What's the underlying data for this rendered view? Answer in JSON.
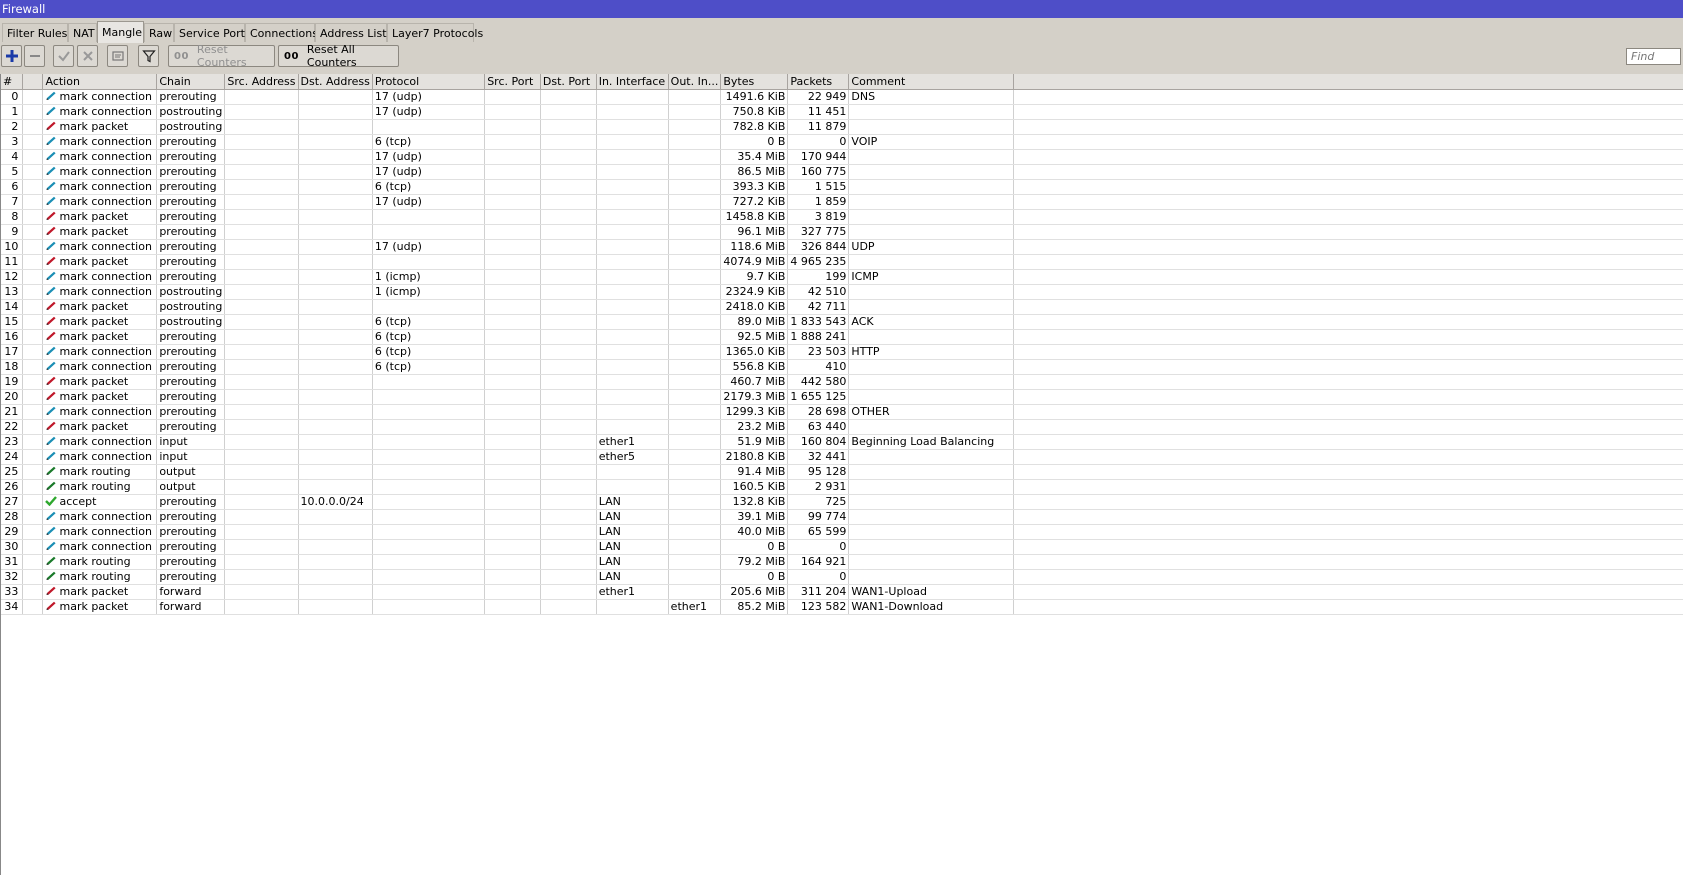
{
  "window": {
    "title": "Firewall"
  },
  "tabs": [
    "Filter Rules",
    "NAT",
    "Mangle",
    "Raw",
    "Service Ports",
    "Connections",
    "Address Lists",
    "Layer7 Protocols"
  ],
  "active_tab": "Mangle",
  "toolbar": {
    "reset_counters": "Reset Counters",
    "reset_all_counters": "Reset All Counters",
    "counter_glyph": "00",
    "find_placeholder": "Find"
  },
  "colors": {
    "title_bar": "#4e4ec8",
    "mark_connection": "#1b8fb5",
    "mark_packet": "#c0182a",
    "mark_routing": "#1a7a2a",
    "accept": "#2ea82e"
  },
  "table": {
    "columns": [
      "#",
      "",
      "Action",
      "Chain",
      "Src. Address",
      "Dst. Address",
      "Protocol",
      "Src. Port",
      "Dst. Port",
      "In. Interface",
      "Out. In...",
      "Bytes",
      "Packets",
      "Comment"
    ],
    "rows": [
      {
        "id": "0",
        "action": "mark connection",
        "chain": "prerouting",
        "src": "",
        "dst": "",
        "proto": "17 (udp)",
        "sport": "",
        "dport": "",
        "in_if": "",
        "out_if": "",
        "bytes": "1491.6 KiB",
        "packets": "22 949",
        "comment": "DNS"
      },
      {
        "id": "1",
        "action": "mark connection",
        "chain": "postrouting",
        "src": "",
        "dst": "",
        "proto": "17 (udp)",
        "sport": "",
        "dport": "",
        "in_if": "",
        "out_if": "",
        "bytes": "750.8 KiB",
        "packets": "11 451",
        "comment": ""
      },
      {
        "id": "2",
        "action": "mark packet",
        "chain": "postrouting",
        "src": "",
        "dst": "",
        "proto": "",
        "sport": "",
        "dport": "",
        "in_if": "",
        "out_if": "",
        "bytes": "782.8 KiB",
        "packets": "11 879",
        "comment": ""
      },
      {
        "id": "3",
        "action": "mark connection",
        "chain": "prerouting",
        "src": "",
        "dst": "",
        "proto": "6 (tcp)",
        "sport": "",
        "dport": "",
        "in_if": "",
        "out_if": "",
        "bytes": "0 B",
        "packets": "0",
        "comment": "VOIP"
      },
      {
        "id": "4",
        "action": "mark connection",
        "chain": "prerouting",
        "src": "",
        "dst": "",
        "proto": "17 (udp)",
        "sport": "",
        "dport": "",
        "in_if": "",
        "out_if": "",
        "bytes": "35.4 MiB",
        "packets": "170 944",
        "comment": ""
      },
      {
        "id": "5",
        "action": "mark connection",
        "chain": "prerouting",
        "src": "",
        "dst": "",
        "proto": "17 (udp)",
        "sport": "",
        "dport": "",
        "in_if": "",
        "out_if": "",
        "bytes": "86.5 MiB",
        "packets": "160 775",
        "comment": ""
      },
      {
        "id": "6",
        "action": "mark connection",
        "chain": "prerouting",
        "src": "",
        "dst": "",
        "proto": "6 (tcp)",
        "sport": "",
        "dport": "",
        "in_if": "",
        "out_if": "",
        "bytes": "393.3 KiB",
        "packets": "1 515",
        "comment": ""
      },
      {
        "id": "7",
        "action": "mark connection",
        "chain": "prerouting",
        "src": "",
        "dst": "",
        "proto": "17 (udp)",
        "sport": "",
        "dport": "",
        "in_if": "",
        "out_if": "",
        "bytes": "727.2 KiB",
        "packets": "1 859",
        "comment": ""
      },
      {
        "id": "8",
        "action": "mark packet",
        "chain": "prerouting",
        "src": "",
        "dst": "",
        "proto": "",
        "sport": "",
        "dport": "",
        "in_if": "",
        "out_if": "",
        "bytes": "1458.8 KiB",
        "packets": "3 819",
        "comment": ""
      },
      {
        "id": "9",
        "action": "mark packet",
        "chain": "prerouting",
        "src": "",
        "dst": "",
        "proto": "",
        "sport": "",
        "dport": "",
        "in_if": "",
        "out_if": "",
        "bytes": "96.1 MiB",
        "packets": "327 775",
        "comment": ""
      },
      {
        "id": "10",
        "action": "mark connection",
        "chain": "prerouting",
        "src": "",
        "dst": "",
        "proto": "17 (udp)",
        "sport": "",
        "dport": "",
        "in_if": "",
        "out_if": "",
        "bytes": "118.6 MiB",
        "packets": "326 844",
        "comment": "UDP"
      },
      {
        "id": "11",
        "action": "mark packet",
        "chain": "prerouting",
        "src": "",
        "dst": "",
        "proto": "",
        "sport": "",
        "dport": "",
        "in_if": "",
        "out_if": "",
        "bytes": "4074.9 MiB",
        "packets": "4 965 235",
        "comment": ""
      },
      {
        "id": "12",
        "action": "mark connection",
        "chain": "prerouting",
        "src": "",
        "dst": "",
        "proto": "1 (icmp)",
        "sport": "",
        "dport": "",
        "in_if": "",
        "out_if": "",
        "bytes": "9.7 KiB",
        "packets": "199",
        "comment": "ICMP"
      },
      {
        "id": "13",
        "action": "mark connection",
        "chain": "postrouting",
        "src": "",
        "dst": "",
        "proto": "1 (icmp)",
        "sport": "",
        "dport": "",
        "in_if": "",
        "out_if": "",
        "bytes": "2324.9 KiB",
        "packets": "42 510",
        "comment": ""
      },
      {
        "id": "14",
        "action": "mark packet",
        "chain": "postrouting",
        "src": "",
        "dst": "",
        "proto": "",
        "sport": "",
        "dport": "",
        "in_if": "",
        "out_if": "",
        "bytes": "2418.0 KiB",
        "packets": "42 711",
        "comment": ""
      },
      {
        "id": "15",
        "action": "mark packet",
        "chain": "postrouting",
        "src": "",
        "dst": "",
        "proto": "6 (tcp)",
        "sport": "",
        "dport": "",
        "in_if": "",
        "out_if": "",
        "bytes": "89.0 MiB",
        "packets": "1 833 543",
        "comment": "ACK"
      },
      {
        "id": "16",
        "action": "mark packet",
        "chain": "prerouting",
        "src": "",
        "dst": "",
        "proto": "6 (tcp)",
        "sport": "",
        "dport": "",
        "in_if": "",
        "out_if": "",
        "bytes": "92.5 MiB",
        "packets": "1 888 241",
        "comment": ""
      },
      {
        "id": "17",
        "action": "mark connection",
        "chain": "prerouting",
        "src": "",
        "dst": "",
        "proto": "6 (tcp)",
        "sport": "",
        "dport": "",
        "in_if": "",
        "out_if": "",
        "bytes": "1365.0 KiB",
        "packets": "23 503",
        "comment": "HTTP"
      },
      {
        "id": "18",
        "action": "mark connection",
        "chain": "prerouting",
        "src": "",
        "dst": "",
        "proto": "6 (tcp)",
        "sport": "",
        "dport": "",
        "in_if": "",
        "out_if": "",
        "bytes": "556.8 KiB",
        "packets": "410",
        "comment": ""
      },
      {
        "id": "19",
        "action": "mark packet",
        "chain": "prerouting",
        "src": "",
        "dst": "",
        "proto": "",
        "sport": "",
        "dport": "",
        "in_if": "",
        "out_if": "",
        "bytes": "460.7 MiB",
        "packets": "442 580",
        "comment": ""
      },
      {
        "id": "20",
        "action": "mark packet",
        "chain": "prerouting",
        "src": "",
        "dst": "",
        "proto": "",
        "sport": "",
        "dport": "",
        "in_if": "",
        "out_if": "",
        "bytes": "2179.3 MiB",
        "packets": "1 655 125",
        "comment": ""
      },
      {
        "id": "21",
        "action": "mark connection",
        "chain": "prerouting",
        "src": "",
        "dst": "",
        "proto": "",
        "sport": "",
        "dport": "",
        "in_if": "",
        "out_if": "",
        "bytes": "1299.3 KiB",
        "packets": "28 698",
        "comment": "OTHER"
      },
      {
        "id": "22",
        "action": "mark packet",
        "chain": "prerouting",
        "src": "",
        "dst": "",
        "proto": "",
        "sport": "",
        "dport": "",
        "in_if": "",
        "out_if": "",
        "bytes": "23.2 MiB",
        "packets": "63 440",
        "comment": ""
      },
      {
        "id": "23",
        "action": "mark connection",
        "chain": "input",
        "src": "",
        "dst": "",
        "proto": "",
        "sport": "",
        "dport": "",
        "in_if": "ether1",
        "out_if": "",
        "bytes": "51.9 MiB",
        "packets": "160 804",
        "comment": "Beginning Load Balancing"
      },
      {
        "id": "24",
        "action": "mark connection",
        "chain": "input",
        "src": "",
        "dst": "",
        "proto": "",
        "sport": "",
        "dport": "",
        "in_if": "ether5",
        "out_if": "",
        "bytes": "2180.8 KiB",
        "packets": "32 441",
        "comment": ""
      },
      {
        "id": "25",
        "action": "mark routing",
        "chain": "output",
        "src": "",
        "dst": "",
        "proto": "",
        "sport": "",
        "dport": "",
        "in_if": "",
        "out_if": "",
        "bytes": "91.4 MiB",
        "packets": "95 128",
        "comment": ""
      },
      {
        "id": "26",
        "action": "mark routing",
        "chain": "output",
        "src": "",
        "dst": "",
        "proto": "",
        "sport": "",
        "dport": "",
        "in_if": "",
        "out_if": "",
        "bytes": "160.5 KiB",
        "packets": "2 931",
        "comment": ""
      },
      {
        "id": "27",
        "action": "accept",
        "chain": "prerouting",
        "src": "",
        "dst": "10.0.0.0/24",
        "proto": "",
        "sport": "",
        "dport": "",
        "in_if": "LAN",
        "out_if": "",
        "bytes": "132.8 KiB",
        "packets": "725",
        "comment": ""
      },
      {
        "id": "28",
        "action": "mark connection",
        "chain": "prerouting",
        "src": "",
        "dst": "",
        "proto": "",
        "sport": "",
        "dport": "",
        "in_if": "LAN",
        "out_if": "",
        "bytes": "39.1 MiB",
        "packets": "99 774",
        "comment": ""
      },
      {
        "id": "29",
        "action": "mark connection",
        "chain": "prerouting",
        "src": "",
        "dst": "",
        "proto": "",
        "sport": "",
        "dport": "",
        "in_if": "LAN",
        "out_if": "",
        "bytes": "40.0 MiB",
        "packets": "65 599",
        "comment": ""
      },
      {
        "id": "30",
        "action": "mark connection",
        "chain": "prerouting",
        "src": "",
        "dst": "",
        "proto": "",
        "sport": "",
        "dport": "",
        "in_if": "LAN",
        "out_if": "",
        "bytes": "0 B",
        "packets": "0",
        "comment": ""
      },
      {
        "id": "31",
        "action": "mark routing",
        "chain": "prerouting",
        "src": "",
        "dst": "",
        "proto": "",
        "sport": "",
        "dport": "",
        "in_if": "LAN",
        "out_if": "",
        "bytes": "79.2 MiB",
        "packets": "164 921",
        "comment": ""
      },
      {
        "id": "32",
        "action": "mark routing",
        "chain": "prerouting",
        "src": "",
        "dst": "",
        "proto": "",
        "sport": "",
        "dport": "",
        "in_if": "LAN",
        "out_if": "",
        "bytes": "0 B",
        "packets": "0",
        "comment": ""
      },
      {
        "id": "33",
        "action": "mark packet",
        "chain": "forward",
        "src": "",
        "dst": "",
        "proto": "",
        "sport": "",
        "dport": "",
        "in_if": "ether1",
        "out_if": "",
        "bytes": "205.6 MiB",
        "packets": "311 204",
        "comment": "WAN1-Upload"
      },
      {
        "id": "34",
        "action": "mark packet",
        "chain": "forward",
        "src": "",
        "dst": "",
        "proto": "",
        "sport": "",
        "dport": "",
        "in_if": "",
        "out_if": "ether1",
        "bytes": "85.2 MiB",
        "packets": "123 582",
        "comment": "WAN1-Download"
      }
    ]
  }
}
